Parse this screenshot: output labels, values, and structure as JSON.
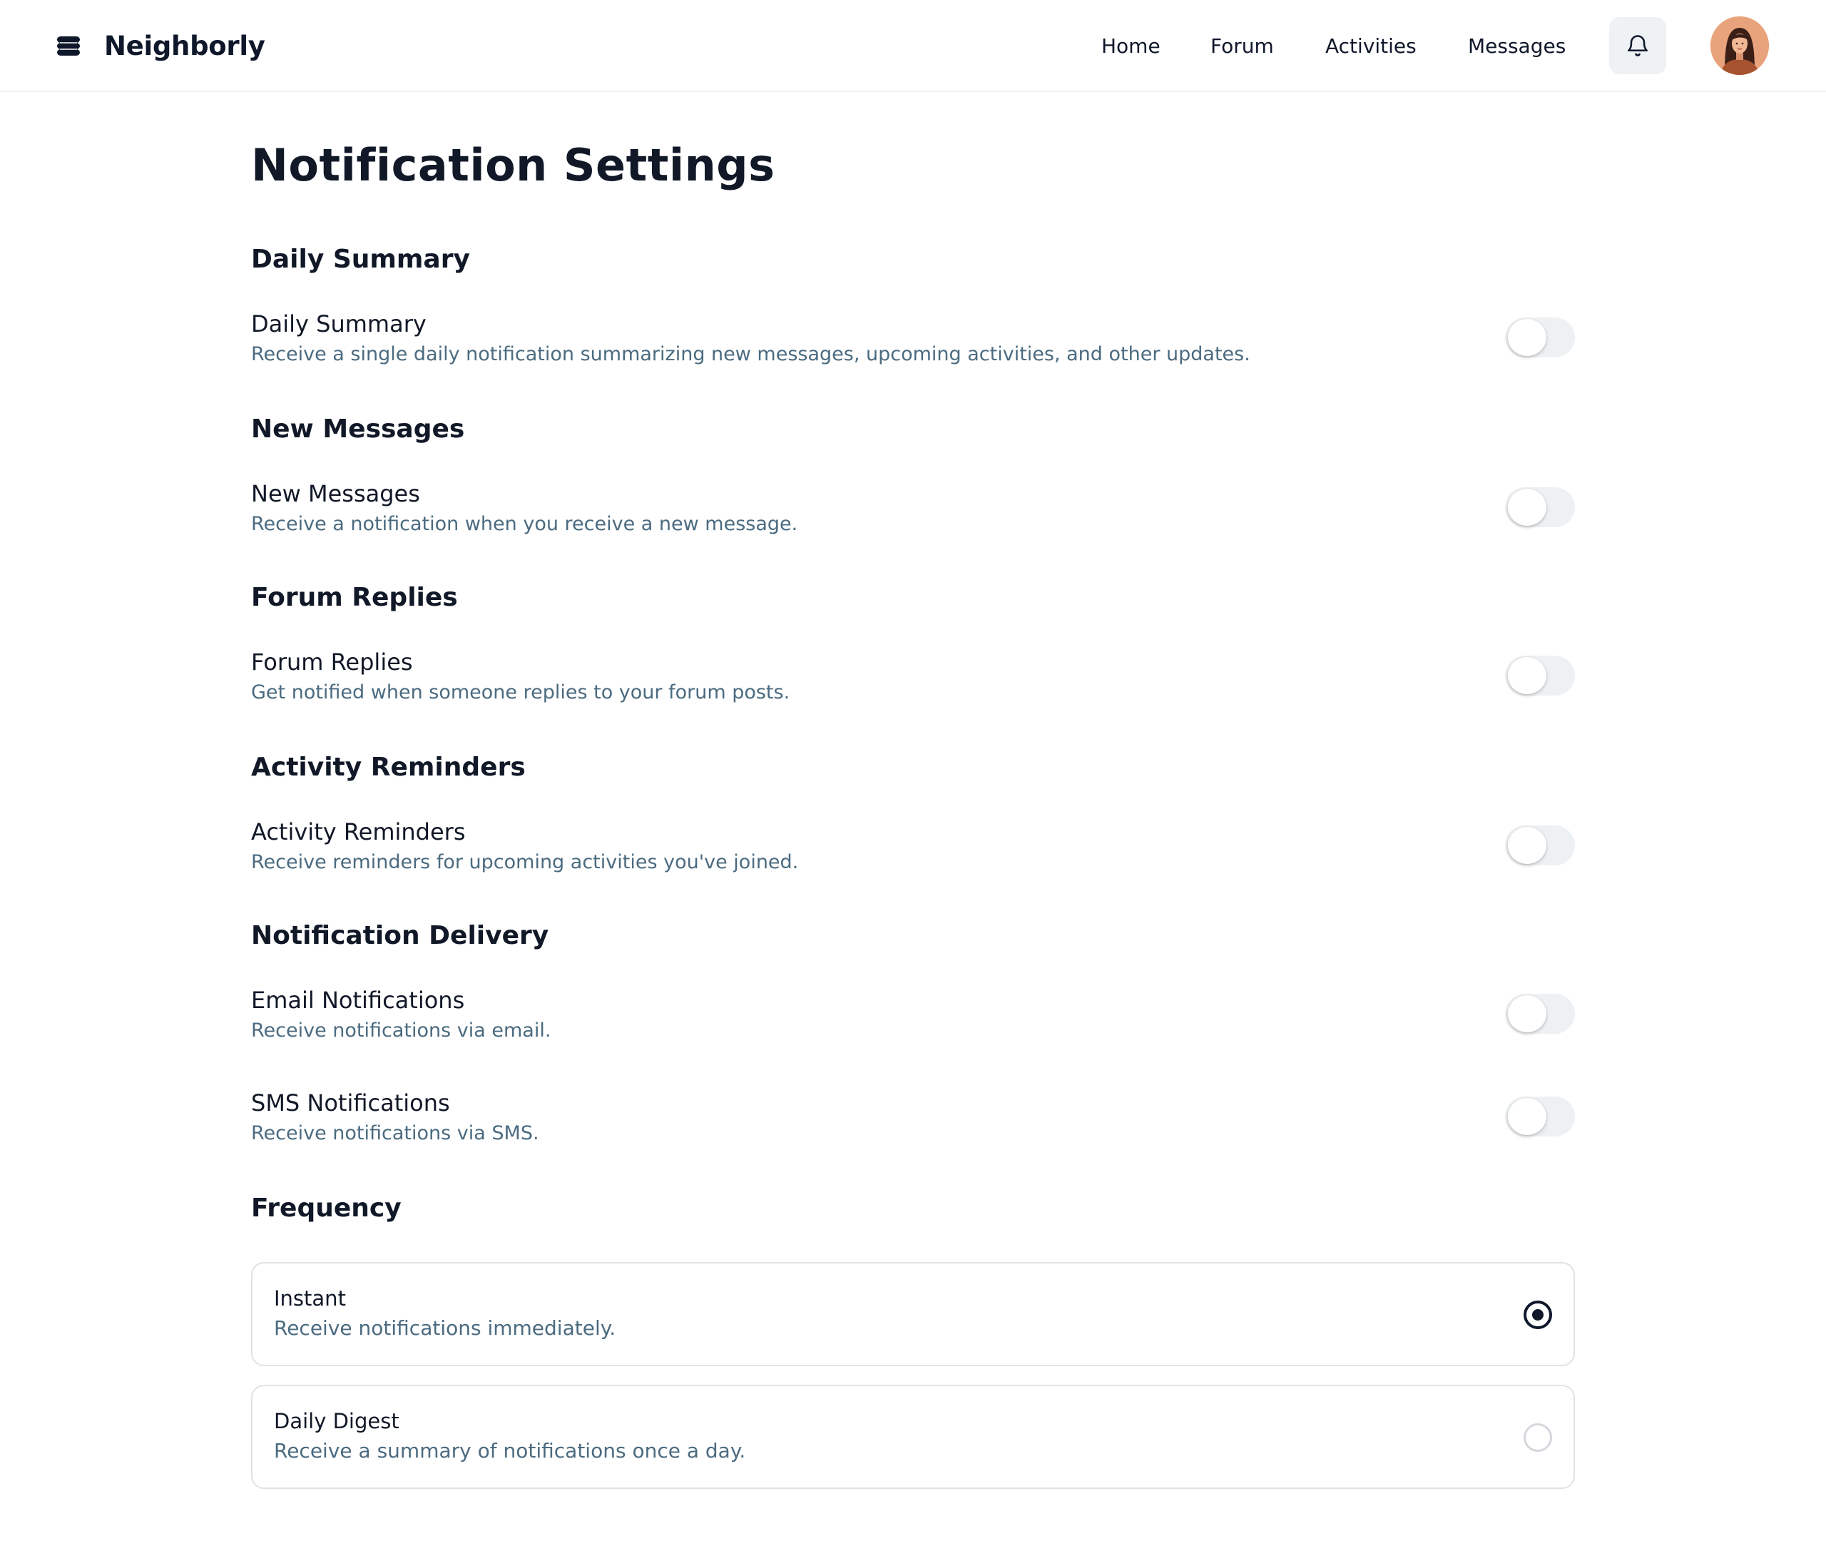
{
  "app": {
    "name": "Neighborly",
    "logo_icon": "stack-logo-icon"
  },
  "nav": {
    "items": [
      {
        "label": "Home"
      },
      {
        "label": "Forum"
      },
      {
        "label": "Activities"
      },
      {
        "label": "Messages"
      }
    ],
    "bell_icon": "bell-icon",
    "avatar_icon": "user-avatar"
  },
  "page": {
    "title": "Notification Settings"
  },
  "sections": {
    "daily_summary": {
      "title": "Daily Summary",
      "setting": {
        "label": "Daily Summary",
        "description": "Receive a single daily notification summarizing new messages, upcoming activities, and other updates.",
        "enabled": false
      }
    },
    "new_messages": {
      "title": "New Messages",
      "setting": {
        "label": "New Messages",
        "description": "Receive a notification when you receive a new message.",
        "enabled": false
      }
    },
    "forum_replies": {
      "title": "Forum Replies",
      "setting": {
        "label": "Forum Replies",
        "description": "Get notified when someone replies to your forum posts.",
        "enabled": false
      }
    },
    "activity_reminders": {
      "title": "Activity Reminders",
      "setting": {
        "label": "Activity Reminders",
        "description": "Receive reminders for upcoming activities you've joined.",
        "enabled": false
      }
    },
    "delivery": {
      "title": "Notification Delivery",
      "email": {
        "label": "Email Notifications",
        "description": "Receive notifications via email.",
        "enabled": false
      },
      "sms": {
        "label": "SMS Notifications",
        "description": "Receive notifications via SMS.",
        "enabled": false
      }
    },
    "frequency": {
      "title": "Frequency",
      "selected": "Instant",
      "options": [
        {
          "label": "Instant",
          "description": "Receive notifications immediately.",
          "selected": true
        },
        {
          "label": "Daily Digest",
          "description": "Receive a summary of notifications once a day.",
          "selected": false
        }
      ]
    }
  },
  "colors": {
    "text_primary": "#111827",
    "text_secondary": "#4b6b80",
    "toggle_off_track": "#eef1f3",
    "card_border": "#dfe3e7",
    "radio_checked": "#0f172a"
  }
}
